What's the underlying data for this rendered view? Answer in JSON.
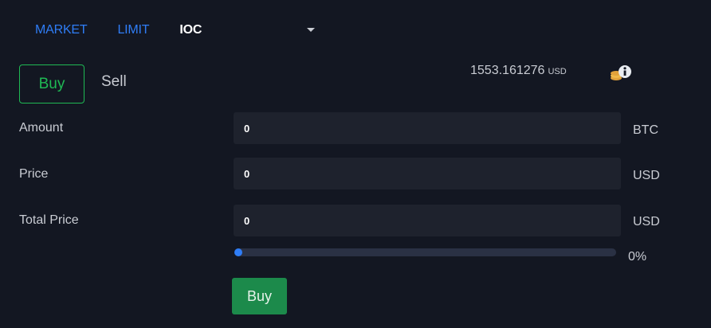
{
  "order_tabs": [
    {
      "label": "MARKET"
    },
    {
      "label": "LIMIT"
    },
    {
      "label": "IOC"
    }
  ],
  "active_tab": "IOC",
  "side_toggle": {
    "buy_label": "Buy",
    "sell_label": "Sell",
    "selected": "Buy"
  },
  "balance": {
    "amount": "1553.161276",
    "unit": "USD",
    "icon": "coins-info-icon"
  },
  "form": {
    "amount": {
      "label": "Amount",
      "value": "0",
      "unit": "BTC"
    },
    "price": {
      "label": "Price",
      "value": "0",
      "unit": "USD"
    },
    "total": {
      "label": "Total Price",
      "value": "0",
      "unit": "USD"
    }
  },
  "slider": {
    "percent_label": "0%",
    "value": 0
  },
  "submit": {
    "label": "Buy"
  },
  "colors": {
    "background": "#131722",
    "accent_blue": "#2f7df6",
    "buy_green": "#1fb954",
    "submit_green": "#1c8a4b",
    "input_bg": "#1e222d"
  }
}
